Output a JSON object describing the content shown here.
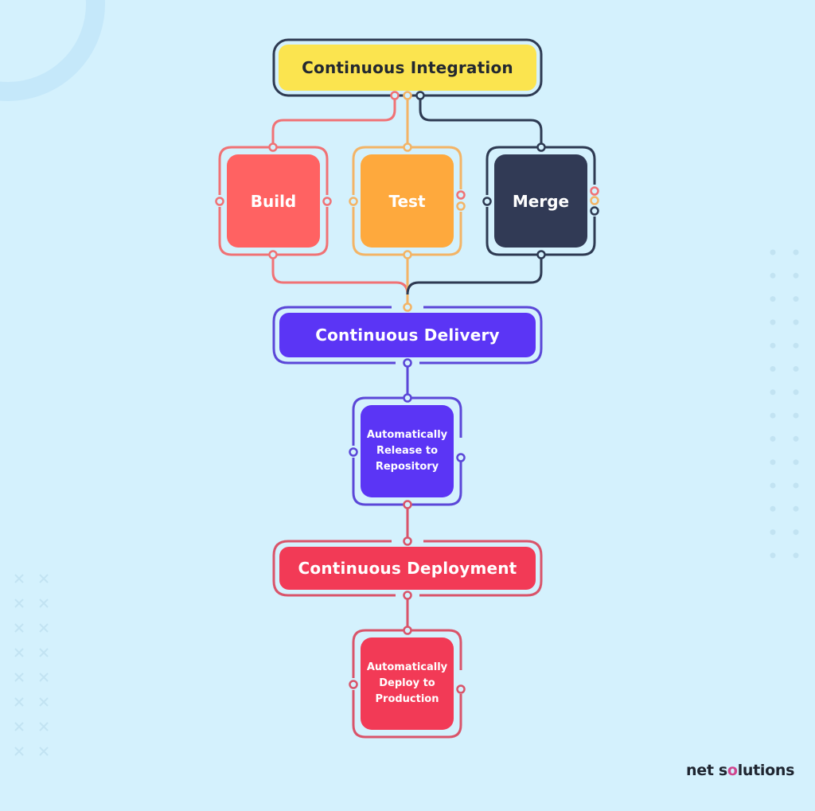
{
  "diagram": {
    "title_nodes": {
      "integration": {
        "label": "Continuous Integration",
        "fill": "#fbe44f",
        "text_color": "#232830",
        "outline": "#2e3a52"
      },
      "delivery": {
        "label": "Continuous Delivery",
        "fill": "#5b35f5",
        "text_color": "#ffffff",
        "outline": "#5b47d8"
      },
      "deployment": {
        "label": "Continuous Deployment",
        "fill": "#f23a56",
        "text_color": "#ffffff",
        "outline": "#d9546a"
      }
    },
    "ci_steps": [
      {
        "label": "Build",
        "fill": "#ff6262",
        "outline": "#f07275"
      },
      {
        "label": "Test",
        "fill": "#fea93d",
        "outline": "#f3b466"
      },
      {
        "label": "Merge",
        "fill": "#313a55",
        "outline": "#2e3a52"
      }
    ],
    "delivery_step": {
      "label": "Automatically Release to Repository",
      "lines": [
        "Automatically",
        "Release to",
        "Repository"
      ],
      "fill": "#5b35f5",
      "outline": "#5b47d8"
    },
    "deployment_step": {
      "label": "Automatically Deploy to Production",
      "lines": [
        "Automatically",
        "Deploy to",
        "Production"
      ],
      "fill": "#f23a56",
      "outline": "#d9546a"
    },
    "flow": [
      "Continuous Integration -> Build",
      "Continuous Integration -> Test",
      "Continuous Integration -> Merge",
      "Build -> Continuous Delivery",
      "Test -> Continuous Delivery",
      "Merge -> Continuous Delivery",
      "Continuous Delivery -> Automatically Release to Repository",
      "Automatically Release to Repository -> Continuous Deployment",
      "Continuous Deployment -> Automatically Deploy to Production"
    ]
  },
  "brand": {
    "logo_text_1": "net s",
    "logo_text_2": "o",
    "logo_text_3": "lutions"
  },
  "colors": {
    "background": "#d4f1fd",
    "decoration": "#c4e6f7"
  }
}
